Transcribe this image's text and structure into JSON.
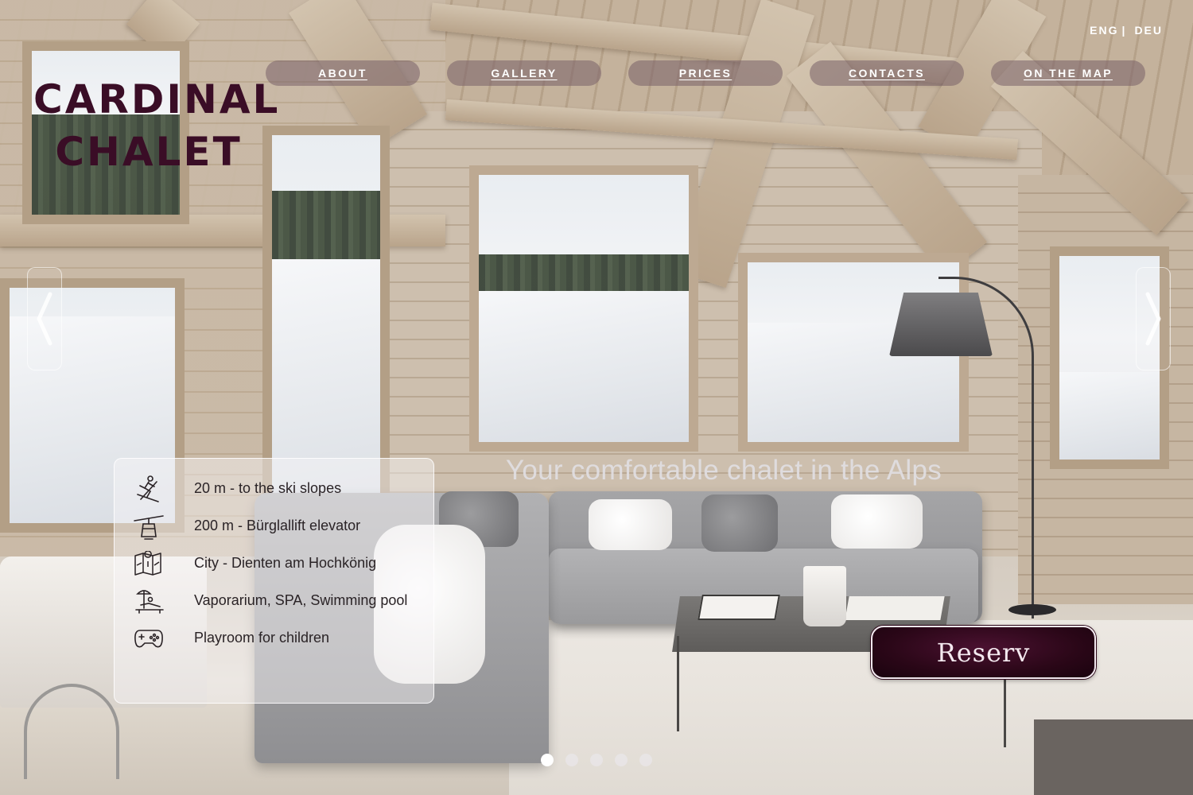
{
  "brand": {
    "line1": "CARDINAL",
    "line2": "CHALET",
    "color": "#3a0d26"
  },
  "language": {
    "current": "ENG",
    "separator": "|",
    "other": "DEU"
  },
  "nav": {
    "items": [
      {
        "label": "ABOUT"
      },
      {
        "label": "GALLERY"
      },
      {
        "label": "PRICES"
      },
      {
        "label": "CONTACTS"
      },
      {
        "label": "ON THE MAP"
      }
    ]
  },
  "slider": {
    "prev_icon": "chevron-left-icon",
    "next_icon": "chevron-right-icon",
    "tagline": "Your comfortable chalet in the Alps",
    "slide_count": 5,
    "active_index": 0
  },
  "features": [
    {
      "icon": "skier-icon",
      "text": "20 m -  to the ski slopes"
    },
    {
      "icon": "cable-car-icon",
      "text": "200 m - Bürglallift elevator"
    },
    {
      "icon": "map-icon",
      "text": "City - Dienten am Hochkönig"
    },
    {
      "icon": "sunbed-icon",
      "text": "Vaporarium, SPA, Swimming pool"
    },
    {
      "icon": "gamepad-icon",
      "text": "Playroom for children"
    }
  ],
  "reserve_button": {
    "label": "Reserv",
    "color": "#2b0718"
  }
}
